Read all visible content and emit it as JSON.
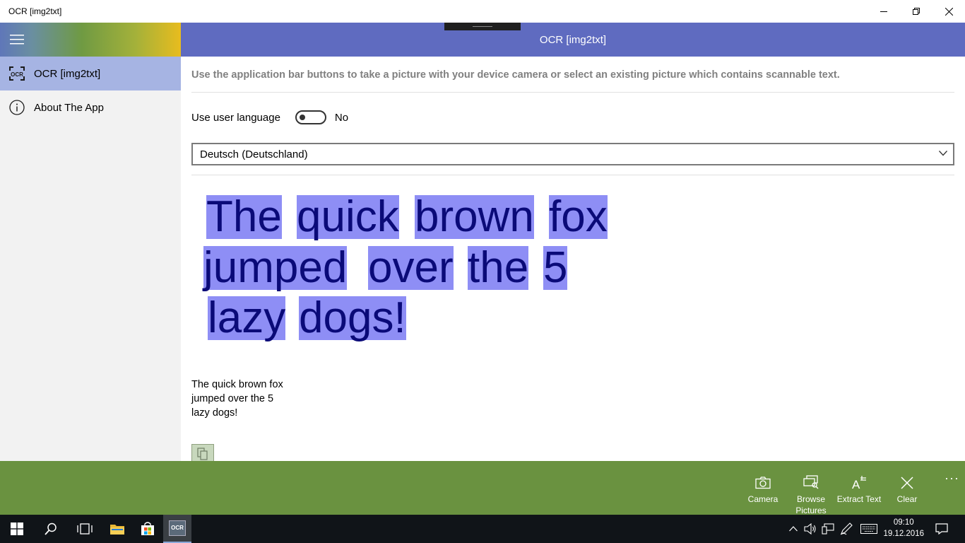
{
  "window": {
    "title": "OCR [img2txt]"
  },
  "nav": {
    "items": [
      {
        "label": "OCR [img2txt]",
        "icon": "ocr-scan-icon"
      },
      {
        "label": "About The App",
        "icon": "info-icon"
      }
    ]
  },
  "header": {
    "title": "OCR [img2txt]"
  },
  "main": {
    "instructions": "Use the application bar buttons to take a picture with your device camera or select an existing picture which contains scannable text.",
    "language_toggle": {
      "label": "Use user language",
      "state": "No",
      "on": false
    },
    "language_select": {
      "value": "Deutsch (Deutschland)"
    },
    "image_words": {
      "w1": "The",
      "w2": "quick",
      "w3": "brown",
      "w4": "fox",
      "w5": "jumped",
      "w6": "over",
      "w7": "the",
      "w8": "5",
      "w9": "lazy",
      "w10": "dogs!"
    },
    "result_lines": [
      "The quick brown fox",
      "jumped over the 5",
      "lazy dogs!"
    ]
  },
  "appbar": {
    "buttons": [
      {
        "label": "Camera",
        "icon": "camera-icon"
      },
      {
        "label": "Browse Pictures",
        "icon": "browse-pictures-icon"
      },
      {
        "label": "Extract Text",
        "icon": "extract-text-icon"
      },
      {
        "label": "Clear",
        "icon": "clear-icon"
      }
    ],
    "more": "···"
  },
  "taskbar": {
    "time": "09:10",
    "date": "19.12.2016",
    "active_app_label": "OCR"
  },
  "colors": {
    "header": "#5f6bc0",
    "nav_selected": "#a6b4e3",
    "appbar": "#6a9240",
    "highlight": "#8e8ef5",
    "ocr_text": "#0a0a78"
  }
}
